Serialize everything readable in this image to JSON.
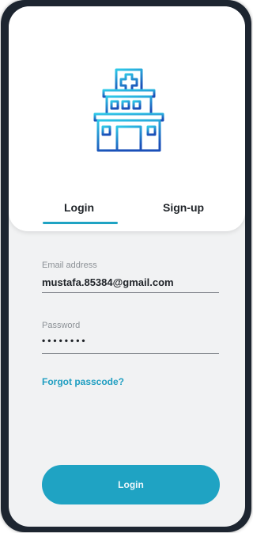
{
  "tabs": [
    {
      "label": "Login",
      "active": true
    },
    {
      "label": "Sign-up",
      "active": false
    }
  ],
  "form": {
    "email_label": "Email address",
    "email_value": "mustafa.85384@gmail.com",
    "password_label": "Password",
    "password_value": "••••••••",
    "forgot_label": "Forgot passcode?",
    "submit_label": "Login"
  },
  "icons": {
    "hero": "hospital-building-icon"
  },
  "colors": {
    "accent": "#1fa3c3",
    "screen_background": "#f1f2f3",
    "card_background": "#ffffff",
    "icon_gradient_start": "#2ec9e8",
    "icon_gradient_end": "#1a4fb8"
  }
}
